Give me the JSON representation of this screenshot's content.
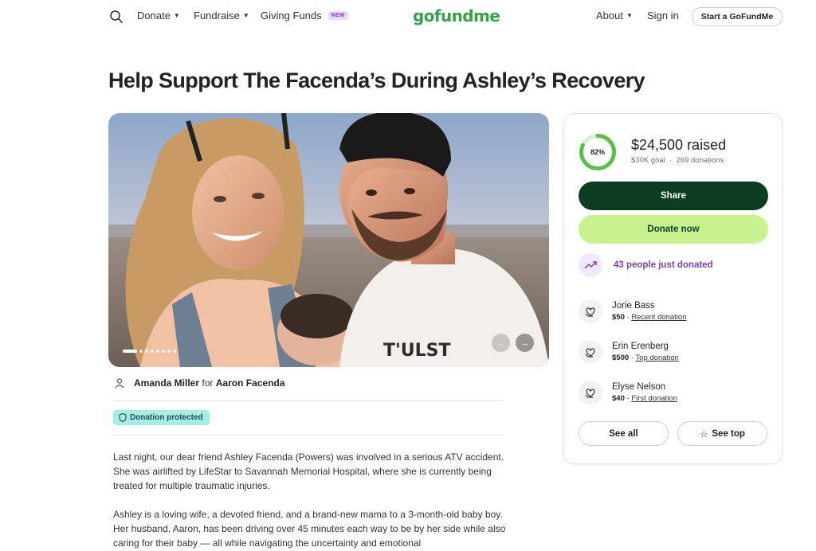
{
  "nav": {
    "donate": "Donate",
    "fundraise": "Fundraise",
    "giving_funds": "Giving Funds",
    "new_badge": "NEW",
    "logo": "gofundme",
    "about": "About",
    "sign_in": "Sign in",
    "start": "Start a GoFundMe"
  },
  "campaign": {
    "title": "Help Support The Facenda’s During Ashley’s Recovery",
    "organizer": "Amanda Miller",
    "for_word": "for",
    "beneficiary": "Aaron Facenda",
    "protected": "Donation protected",
    "story": [
      "Last night, our dear friend Ashley Facenda (Powers) was involved in a serious ATV accident. She was airlifted by LifeStar to Savannah Memorial Hospital, where she is currently being treated for multiple traumatic injuries.",
      "Ashley is a loving wife, a devoted friend, and a brand-new mama to a 3-month-old baby boy. Her husband, Aaron, has been driving over 45 minutes each way to be by her side while also caring for their baby — all while navigating the uncertainty and emotional"
    ],
    "gallery_count": 8,
    "gallery_active": 0
  },
  "card": {
    "percent": 82,
    "percent_label": "82%",
    "raised": "$24,500 raised",
    "goal": "$30K goal",
    "donations": "269 donations",
    "share": "Share",
    "donate_now": "Donate now",
    "recent_count": "43 people just donated",
    "donors": [
      {
        "name": "Jorie Bass",
        "amount": "$50",
        "tag": "Recent donation"
      },
      {
        "name": "Erin Erenberg",
        "amount": "$500",
        "tag": "Top donation"
      },
      {
        "name": "Elyse Nelson",
        "amount": "$40",
        "tag": "First donation"
      }
    ],
    "see_all": "See all",
    "see_top": "See top"
  },
  "colors": {
    "brand_green": "#0b3d23",
    "donate_lime": "#c8f28e",
    "progress_green": "#5cbf4b",
    "purple": "#7a3fb8",
    "protected_teal": "#a7ece6"
  }
}
